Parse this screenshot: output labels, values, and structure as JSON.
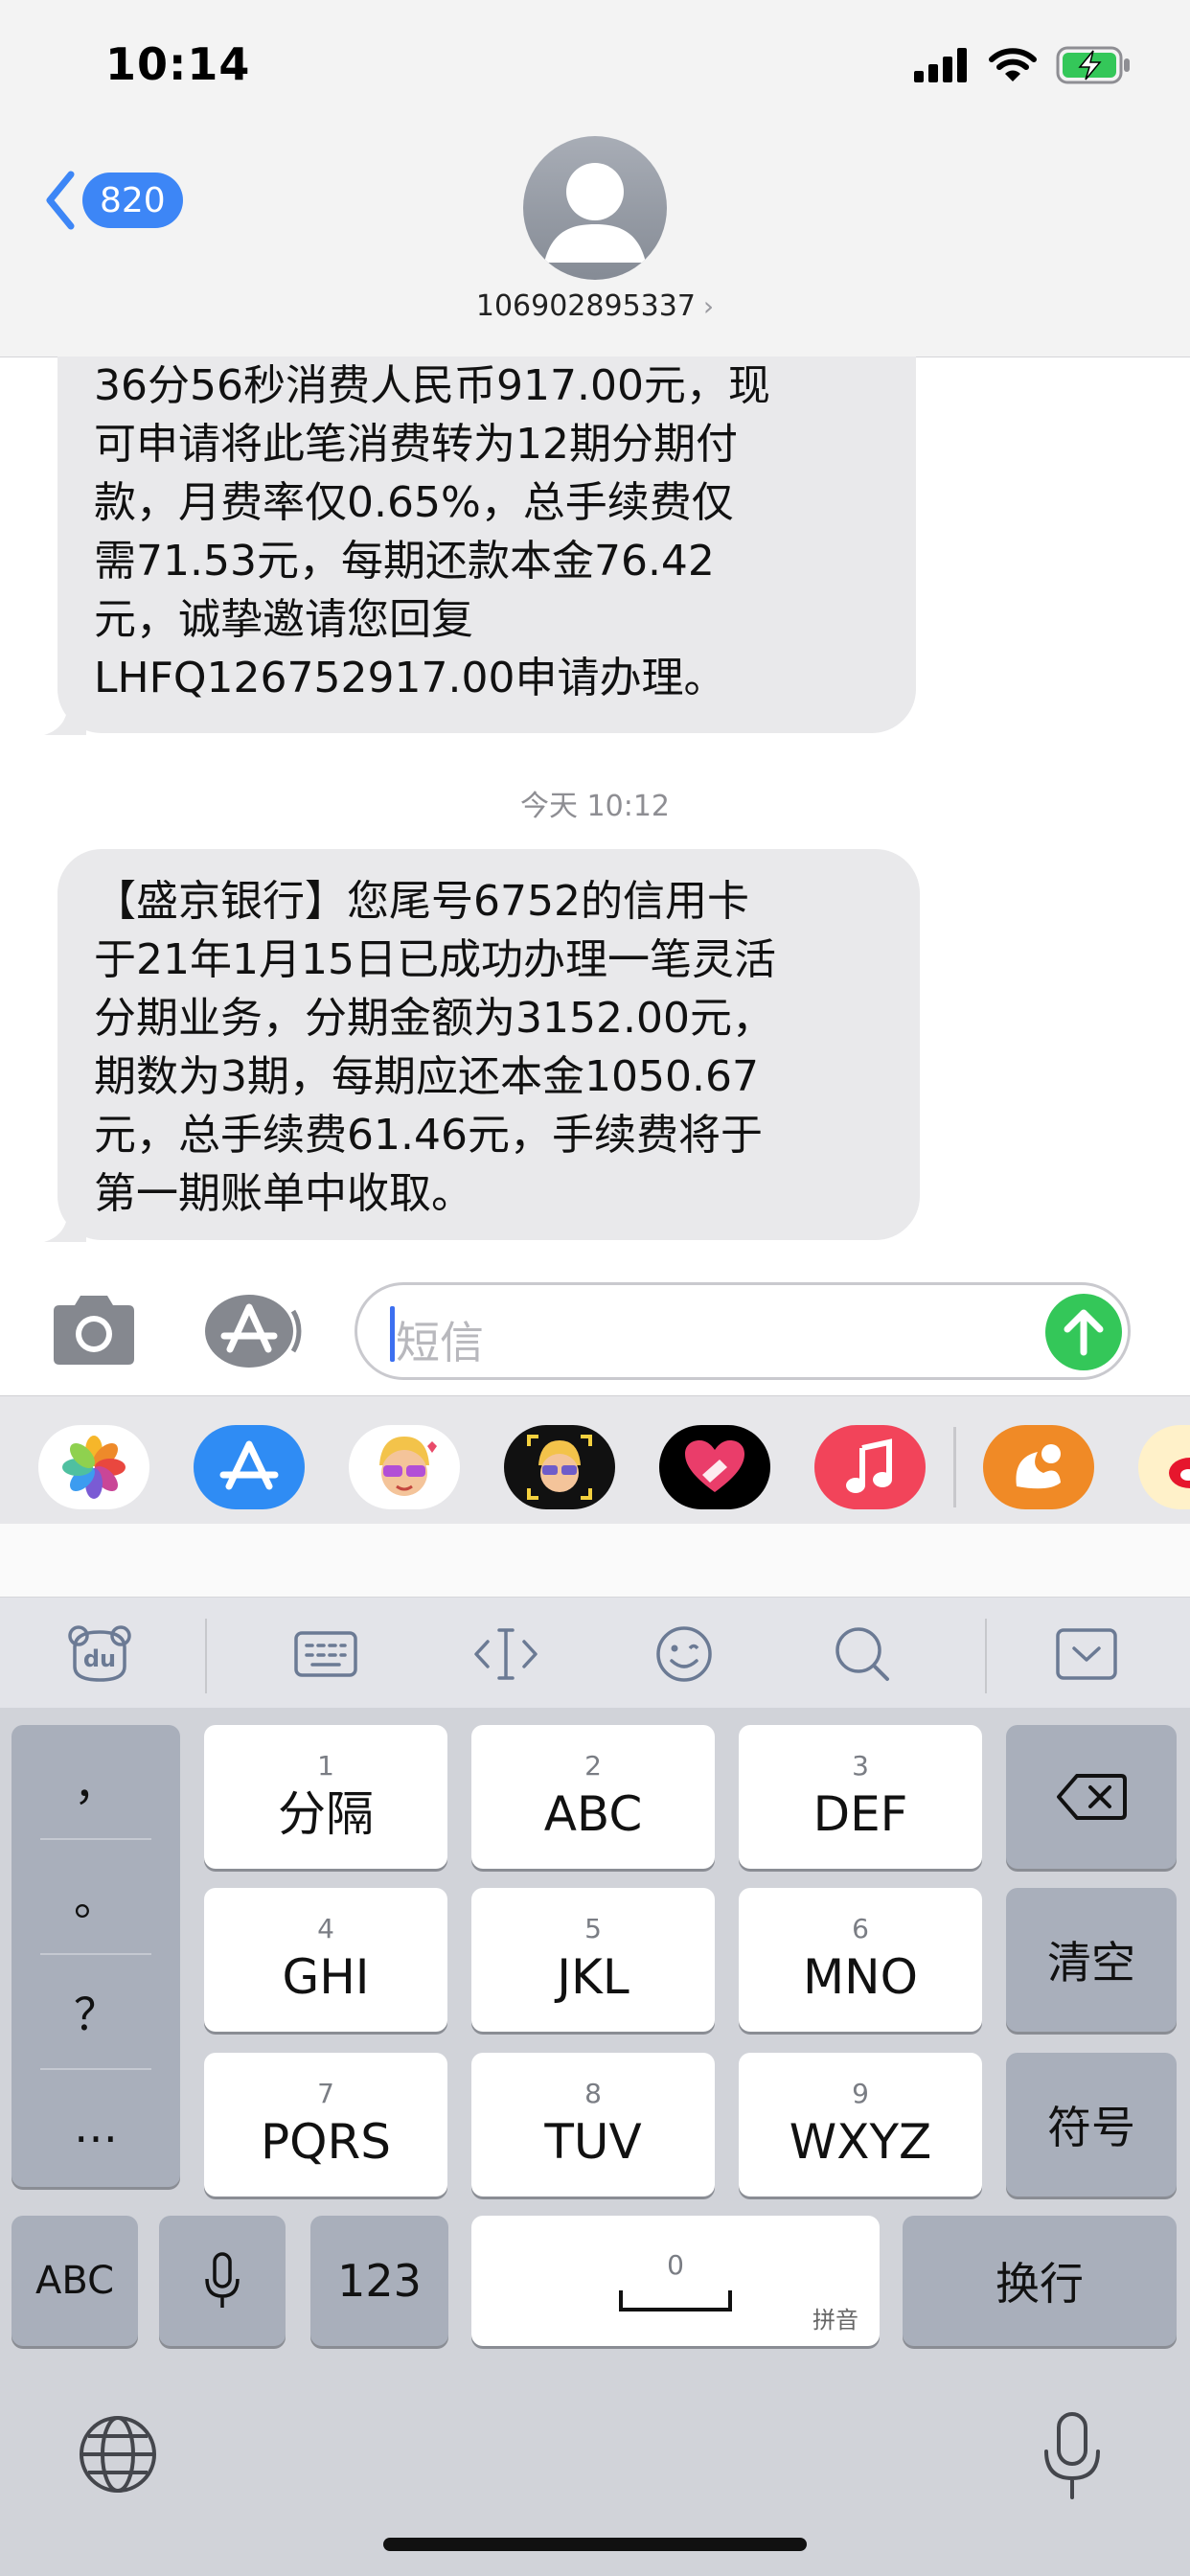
{
  "status_bar": {
    "time": "10:14",
    "icons": [
      "cellular-signal-icon",
      "wifi-icon",
      "battery-charging-icon"
    ]
  },
  "nav": {
    "back_count": "820",
    "contact": "106902895337",
    "contact_chevron": "›"
  },
  "messages": [
    {
      "lines": [
        "36分56秒消费人民币917.00元，现",
        "可申请将此笔消费转为12期分期付",
        "款，月费率仅0.65%，总手续费仅",
        "需71.53元，每期还款本金76.42",
        "元，诚挚邀请您回复",
        "LHFQ126752917.00申请办理。"
      ]
    },
    {
      "timestamp": "今天 10:12"
    },
    {
      "lines": [
        "【盛京银行】您尾号6752的信用卡",
        "于21年1月15日已成功办理一笔灵活",
        "分期业务，分期金额为3152.00元，",
        "期数为3期，每期应还本金1050.67",
        "元，总手续费61.46元，手续费将于",
        "第一期账单中收取。"
      ]
    }
  ],
  "input": {
    "placeholder": "短信"
  },
  "app_drawer": [
    "photos-app-icon",
    "app-store-icon",
    "memoji-stickers-icon",
    "memoji-camera-icon",
    "digital-touch-icon",
    "music-app-icon",
    "uc-browser-icon",
    "weibo-icon"
  ],
  "keyboard": {
    "toolbar": [
      "du-logo-icon",
      "keyboard-icon",
      "cursor-move-icon",
      "emoji-icon",
      "search-icon",
      "collapse-keyboard-icon"
    ],
    "side_punct": [
      "，",
      "。",
      "？",
      "…"
    ],
    "keys": [
      {
        "num": "1",
        "label": "分隔"
      },
      {
        "num": "2",
        "label": "ABC"
      },
      {
        "num": "3",
        "label": "DEF"
      },
      {
        "num": "4",
        "label": "GHI"
      },
      {
        "num": "5",
        "label": "JKL"
      },
      {
        "num": "6",
        "label": "MNO"
      },
      {
        "num": "7",
        "label": "PQRS"
      },
      {
        "num": "8",
        "label": "TUV"
      },
      {
        "num": "9",
        "label": "WXYZ"
      }
    ],
    "right_keys": {
      "clear": "清空",
      "symbols": "符号"
    },
    "bottom": {
      "abc": "ABC",
      "numbers": "123",
      "space_num": "0",
      "pinyin": "拼音",
      "return": "换行"
    }
  }
}
